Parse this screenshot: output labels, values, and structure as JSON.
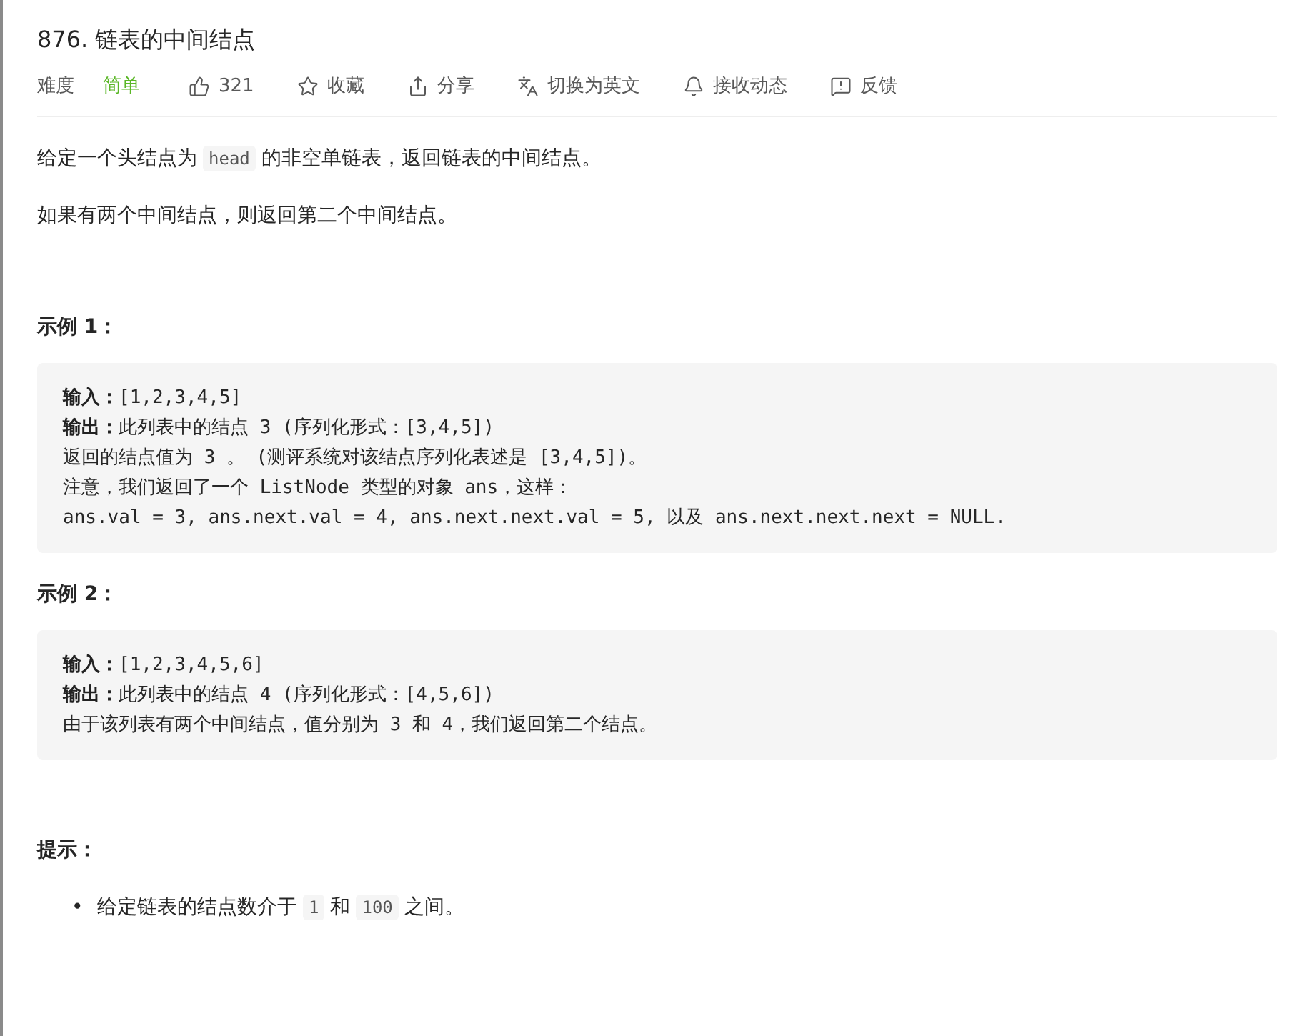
{
  "title": "876. 链表的中间结点",
  "toolbar": [
    {
      "kind": "difficulty",
      "label": "难度",
      "value": "简单"
    },
    {
      "kind": "like",
      "label": "321"
    },
    {
      "kind": "star",
      "label": "收藏"
    },
    {
      "kind": "share",
      "label": "分享"
    },
    {
      "kind": "translate",
      "label": "切换为英文"
    },
    {
      "kind": "bell",
      "label": "接收动态"
    },
    {
      "kind": "feedback",
      "label": "反馈"
    }
  ],
  "description": [
    [
      {
        "kind": "text",
        "text": "给定一个头结点为"
      },
      {
        "kind": "code",
        "text": "head"
      },
      {
        "kind": "text",
        "text": "的非空单链表，返回链表的中间结点。"
      }
    ],
    [
      {
        "kind": "text",
        "text": "如果有两个中间结点，则返回第二个中间结点。"
      }
    ]
  ],
  "examples": [
    {
      "heading": "示例 1：",
      "lines": [
        "**输入：**[1,2,3,4,5]",
        "**输出：**此列表中的结点 3 (序列化形式：[3,4,5])",
        "返回的结点值为 3 。 (测评系统对该结点序列化表述是 [3,4,5])。",
        "注意，我们返回了一个 ListNode 类型的对象 ans，这样：",
        "ans.val = 3, ans.next.val = 4, ans.next.next.val = 5, 以及 ans.next.next.next = NULL."
      ]
    },
    {
      "heading": "示例 2：",
      "lines": [
        "**输入：**[1,2,3,4,5,6]",
        "**输出：**此列表中的结点 4 (序列化形式：[4,5,6])",
        "由于该列表有两个中间结点，值分别为 3 和 4，我们返回第二个结点。"
      ]
    }
  ],
  "hints": {
    "heading": "提示：",
    "items": [
      {
        "bullet": "•",
        "segments": [
          {
            "kind": "text",
            "text": "给定链表的结点数介于"
          },
          {
            "kind": "code",
            "text": "1"
          },
          {
            "kind": "text",
            "text": "和"
          },
          {
            "kind": "code",
            "text": "100"
          },
          {
            "kind": "text",
            "text": "之间。"
          }
        ]
      }
    ]
  }
}
